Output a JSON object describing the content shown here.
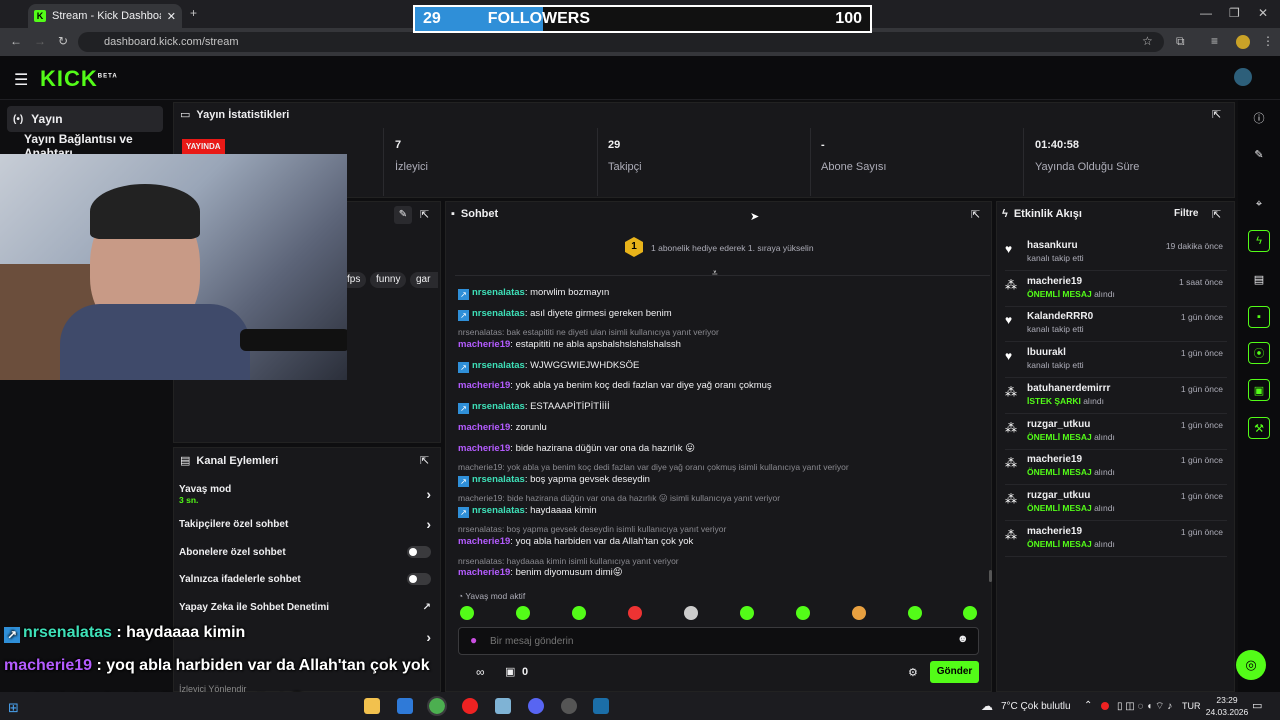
{
  "browser": {
    "tab_title": "Stream - Kick Dashboard",
    "url": "dashboard.kick.com/stream"
  },
  "goal": {
    "current": "29",
    "label": "FOLLOWERS",
    "target": "100",
    "progress": 0.29
  },
  "sidebar": {
    "item1": "Yayın",
    "item2": "Yayın Bağlantısı ve Anahtarı"
  },
  "stats": {
    "title": "Yayın İstatistikleri",
    "live": "YAYINDA",
    "viewers_val": "7",
    "viewers_lbl": "İzleyici",
    "followers_val": "29",
    "followers_lbl": "Takipçi",
    "subs_val": "-",
    "subs_lbl": "Abone Sayısı",
    "uptime_val": "01:40:58",
    "uptime_lbl": "Yayında Olduğu Süre"
  },
  "tags": [
    "fps",
    "funny",
    "gar"
  ],
  "chat": {
    "title": "Sohbet",
    "gift_badge": "1",
    "gift_text": "1 abonelik hediye ederek 1. sıraya yükselin",
    "messages": [
      {
        "user": "nrsenalatas",
        "text": ": morwlim bozmayın"
      },
      {
        "user": "nrsenalatas",
        "text": ": asıl diyete girmesi gereken benim"
      },
      {
        "reply": "nrsenalatas: bak estapititi ne diyeti ulan isimli kullanıcıya yanıt veriyor"
      },
      {
        "user": "macherie19",
        "text": ": estapititi ne abla apsbalshslshslshalssh"
      },
      {
        "user": "nrsenalatas",
        "text": ": WJWGGWIEJWHDKSÖE"
      },
      {
        "user": "macherie19",
        "text": ": yok abla ya benim koç dedi fazlan var diye yağ oranı çokmuş"
      },
      {
        "user": "nrsenalatas",
        "text": ": ESTAAAPİTİPİTİİİİ"
      },
      {
        "user": "macherie19",
        "text": ": zorunlu"
      },
      {
        "user": "macherie19",
        "text": ": bide hazirana düğün var ona da hazırlık 😛"
      },
      {
        "reply": "macherie19: yok abla ya benim koç dedi fazlan var diye yağ oranı çokmuş isimli kullanıcıya yanıt veriyor"
      },
      {
        "user": "nrsenalatas",
        "text": ": boş yapma gevsek deseydin"
      },
      {
        "reply": "macherie19: bide hazirana düğün var ona da hazırlık 😛 isimli kullanıcıya yanıt veriyor"
      },
      {
        "user": "nrsenalatas",
        "text": ": haydaaaa kimin"
      },
      {
        "reply": "nrsenalatas: boş yapma gevsek deseydin isimli kullanıcıya yanıt veriyor"
      },
      {
        "user": "macherie19",
        "text": ": yoq abla harbiden var da Allah'tan çok yok"
      },
      {
        "reply": "nrsenalatas: haydaaaa kimin isimli kullanıcıya yanıt veriyor"
      },
      {
        "user": "macherie19",
        "text": ": benim diyomusum dimi😝"
      }
    ],
    "slow_mode": "Yavaş mod aktif",
    "placeholder": "Bir mesaj gönderin",
    "count": "0",
    "send": "Gönder"
  },
  "events": {
    "title": "Etkinlik Akışı",
    "filter": "Filtre",
    "items": [
      {
        "name": "hasankuru",
        "sub": "kanalı takip etti",
        "time": "19 dakika önce",
        "kind": "follow"
      },
      {
        "name": "macherie19",
        "hl": "ÖNEMLİ MESAJ",
        "sub": " alındı",
        "time": "1 saat önce",
        "kind": "redeem"
      },
      {
        "name": "KalandeRRR0",
        "sub": "kanalı takip etti",
        "time": "1 gün önce",
        "kind": "follow"
      },
      {
        "name": "lbuurakl",
        "sub": "kanalı takip etti",
        "time": "1 gün önce",
        "kind": "follow"
      },
      {
        "name": "batuhanerdemirrr",
        "hl": "İSTEK ŞARKI",
        "sub": " alındı",
        "time": "1 gün önce",
        "kind": "redeem"
      },
      {
        "name": "ruzgar_utkuu",
        "hl": "ÖNEMLİ MESAJ",
        "sub": " alındı",
        "time": "1 gün önce",
        "kind": "redeem"
      },
      {
        "name": "macherie19",
        "hl": "ÖNEMLİ MESAJ",
        "sub": " alındı",
        "time": "1 gün önce",
        "kind": "redeem"
      },
      {
        "name": "ruzgar_utkuu",
        "hl": "ÖNEMLİ MESAJ",
        "sub": " alındı",
        "time": "1 gün önce",
        "kind": "redeem"
      },
      {
        "name": "macherie19",
        "hl": "ÖNEMLİ MESAJ",
        "sub": " alındı",
        "time": "1 gün önce",
        "kind": "redeem"
      }
    ]
  },
  "actions": {
    "title": "Kanal Eylemleri",
    "slow": "Yavaş mod",
    "slow_sub": "3 sn.",
    "followers_only": "Takipçilere özel sohbet",
    "subs_only": "Abonelere özel sohbet",
    "emotes_only": "Yalnızca ifadelerle sohbet",
    "ai": "Yapay Zeka ile Sohbet Denetimi",
    "more1": "İzleyici Yönlendir"
  },
  "overlay": [
    {
      "user": "nrsenalatas",
      "text": " : haydaaaa kimin"
    },
    {
      "user": "macherie19",
      "text": " : yoq abla harbiden var da Allah'tan çok yok"
    },
    {
      "user": "macherie19",
      "text": " : benim diyomusum dimi 😝"
    }
  ],
  "taskbar": {
    "weather": "7°C  Çok bulutlu",
    "lang": "TUR",
    "time": "23:29",
    "date": "24.03.2026"
  },
  "colors": {
    "accent": "#53fc18",
    "nrs": "#3ee0b8",
    "mac": "#b45cff",
    "goal_fill": "#2f8fd8"
  }
}
